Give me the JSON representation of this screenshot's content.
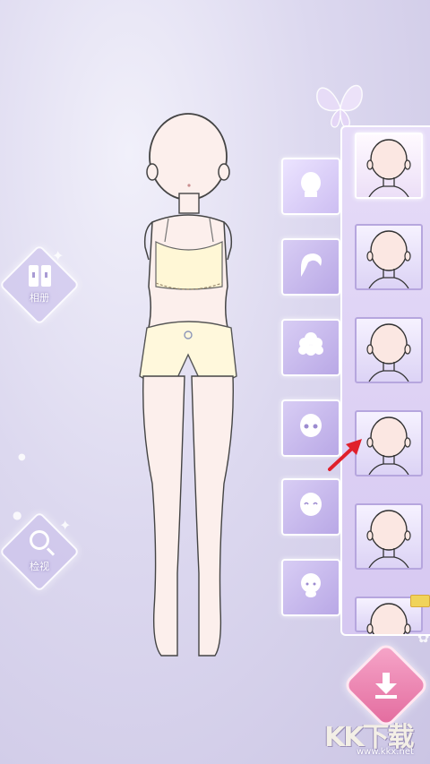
{
  "side_buttons": {
    "album_label": "相册",
    "inspect_label": "检视"
  },
  "categories": [
    {
      "icon": "face-icon",
      "active": true
    },
    {
      "icon": "hair-icon",
      "active": false
    },
    {
      "icon": "curly-hair-icon",
      "active": false
    },
    {
      "icon": "eyes-icon",
      "active": false
    },
    {
      "icon": "smile-icon",
      "active": false
    },
    {
      "icon": "head-shape-icon",
      "active": false
    }
  ],
  "items": [
    {
      "icon": "head-outline-icon",
      "selected": true
    },
    {
      "icon": "head-outline-icon",
      "selected": false
    },
    {
      "icon": "head-outline-icon",
      "selected": false
    },
    {
      "icon": "head-outline-icon",
      "selected": false
    },
    {
      "icon": "head-outline-icon",
      "selected": false
    },
    {
      "icon": "head-outline-icon",
      "selected": false
    }
  ],
  "download": {
    "icon": "download-icon"
  },
  "watermark": {
    "text": "KK下载",
    "url": "www.kkx.net"
  },
  "colors": {
    "background": "#d9d4ee",
    "panel": "#ddd1f4",
    "accent_pink": "#e8739f",
    "arrow_red": "#e0202b",
    "skin": "#fbeae6",
    "outfit": "#fff7d6"
  }
}
